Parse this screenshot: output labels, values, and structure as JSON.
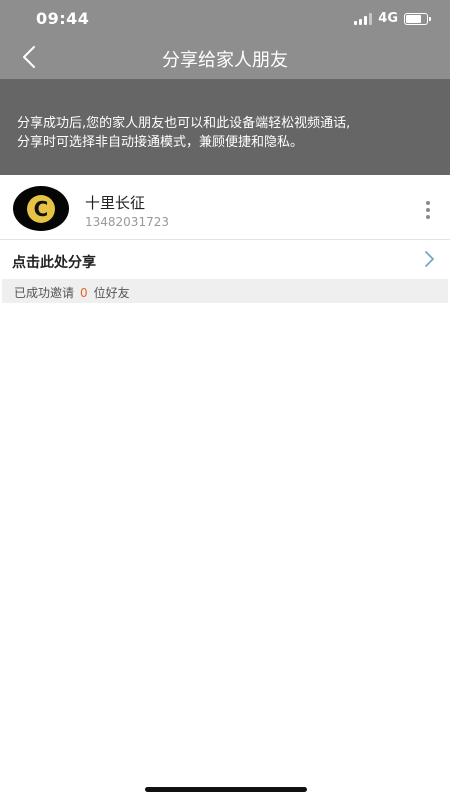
{
  "status_bar": {
    "time": "09:44",
    "network": "4G",
    "battery_level": 0.75
  },
  "nav": {
    "title": "分享给家人朋友",
    "back_icon": "chevron-left-icon"
  },
  "banner": {
    "text": "分享成功后,您的家人朋友也可以和此设备端轻松视频通话,\n分享时可选择非自动接通模式，兼顾便捷和隐私。"
  },
  "contact": {
    "avatar_letter": "C",
    "name": "十里长征",
    "phone": "13482031723",
    "more_icon": "more-vertical-icon"
  },
  "share": {
    "label": "点击此处分享",
    "chevron_icon": "chevron-right-icon"
  },
  "invite": {
    "prefix": "已成功邀请",
    "count": "0",
    "suffix": "位好友"
  },
  "colors": {
    "header_bg": "#8e8e8e",
    "banner_bg": "#666666",
    "accent": "#e0662a",
    "chevron": "#7aa7c0"
  }
}
